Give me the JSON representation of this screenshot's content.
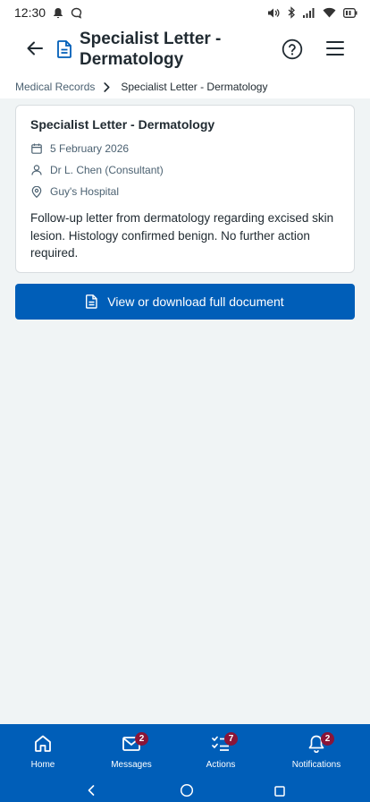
{
  "status_bar": {
    "time": "12:30",
    "left_icons": [
      "bell-icon",
      "chat-bubble-icon"
    ],
    "right_icons": [
      "volume-icon",
      "bluetooth-icon",
      "signal-icon",
      "wifi-icon",
      "battery-icon"
    ]
  },
  "header": {
    "title": "Specialist Letter - Dermatology",
    "icons": [
      "back-arrow-icon",
      "document-icon",
      "help-icon",
      "menu-icon"
    ]
  },
  "breadcrumb": {
    "parent": "Medical Records",
    "current": "Specialist Letter - Dermatology"
  },
  "card": {
    "title": "Specialist Letter - Dermatology",
    "date": "5 February 2026",
    "doctor": "Dr L. Chen (Consultant)",
    "location": "Guy's Hospital",
    "body": "Follow-up letter from dermatology regarding excised skin lesion. Histology confirmed benign. No further action required."
  },
  "primary_button": {
    "label": "View or download full document"
  },
  "bottom_nav": {
    "items": [
      {
        "label": "Home",
        "icon": "home-icon",
        "badge": ""
      },
      {
        "label": "Messages",
        "icon": "envelope-icon",
        "badge": "2"
      },
      {
        "label": "Actions",
        "icon": "checklist-icon",
        "badge": "7"
      },
      {
        "label": "Notifications",
        "icon": "bell-icon",
        "badge": "2"
      }
    ]
  },
  "colors": {
    "brand_blue": "#005eb8",
    "badge": "#8a1538",
    "background": "#f0f4f5",
    "text": "#212b32",
    "secondary_text": "#4c6272"
  }
}
